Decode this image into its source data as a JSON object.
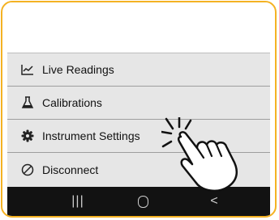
{
  "menu": {
    "items": [
      {
        "label": "Live Readings",
        "icon": "chart-icon"
      },
      {
        "label": "Calibrations",
        "icon": "flask-icon"
      },
      {
        "label": "Instrument Settings",
        "icon": "gear-icon"
      },
      {
        "label": "Disconnect",
        "icon": "disconnect-icon"
      }
    ]
  },
  "navbar": {
    "recents_glyph": "|||",
    "home_glyph": "O",
    "back_glyph": "<"
  },
  "colors": {
    "frame_border": "#f4b223",
    "menu_bg": "#e6e6e6",
    "navbar_bg": "#121212"
  }
}
